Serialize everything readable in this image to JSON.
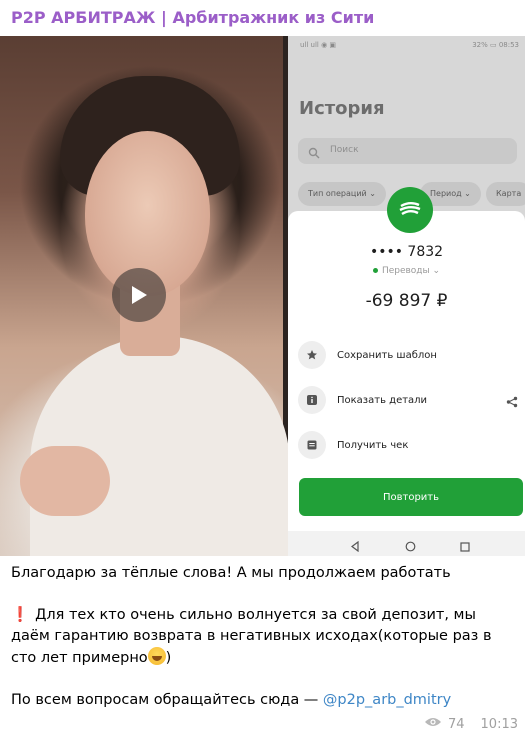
{
  "channel": {
    "title": "P2P АРБИТРАЖ | Арбитражник из Сити"
  },
  "media": {
    "phone": {
      "status_left": "ull ull ◉ ▣",
      "status_right": "32% ▭ 08:53",
      "history_title": "История",
      "search_placeholder": "Поиск",
      "filters": [
        "Тип операций ⌄",
        "Период ⌄",
        "Карта"
      ],
      "card_number": "•••• 7832",
      "category": "Переводы ⌄",
      "amount": "-69 897 ₽",
      "actions": [
        {
          "label": "Сохранить шаблон",
          "icon": "star-icon"
        },
        {
          "label": "Показать детали",
          "icon": "info-icon"
        },
        {
          "label": "Получить чек",
          "icon": "receipt-icon"
        }
      ],
      "repeat_label": "Повторить"
    }
  },
  "message": {
    "line1": "Благодарю за тёплые слова! А мы продолжаем работать",
    "exclaim": "❗",
    "para2": "Для тех кто очень сильно волнуется за свой депозит, мы даём гарантию возврата в негативных исходах(которые раз в сто лет примерно",
    "para2_end": ")",
    "line3_prefix": "По всем вопросам обращайтесь сюда — ",
    "line3_link": "@p2p_arb_dmitry"
  },
  "meta": {
    "views": "74",
    "time": "10:13"
  },
  "colors": {
    "accent": "#9b5ec8",
    "sber_green": "#21a038",
    "link": "#3e86c6"
  }
}
